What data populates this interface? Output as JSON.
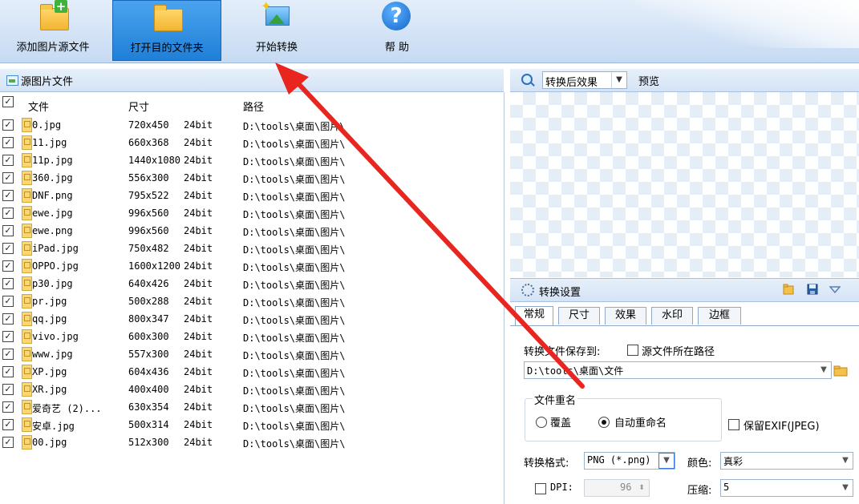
{
  "toolbar": {
    "add_label": "添加图片源文件",
    "open_label": "打开目的文件夹",
    "start_label": "开始转换",
    "help_label": "帮 助"
  },
  "left_panel": {
    "title": "源图片文件",
    "columns": {
      "file": "文件",
      "size": "尺寸",
      "path": "路径"
    },
    "rows": [
      {
        "name": "0.jpg",
        "size": "720x450",
        "bit": "24bit",
        "path": "D:\\tools\\桌面\\图片\\"
      },
      {
        "name": "11.jpg",
        "size": "660x368",
        "bit": "24bit",
        "path": "D:\\tools\\桌面\\图片\\"
      },
      {
        "name": "11p.jpg",
        "size": "1440x1080",
        "bit": "24bit",
        "path": "D:\\tools\\桌面\\图片\\"
      },
      {
        "name": "360.jpg",
        "size": "556x300",
        "bit": "24bit",
        "path": "D:\\tools\\桌面\\图片\\"
      },
      {
        "name": "DNF.png",
        "size": "795x522",
        "bit": "24bit",
        "path": "D:\\tools\\桌面\\图片\\"
      },
      {
        "name": "ewe.jpg",
        "size": "996x560",
        "bit": "24bit",
        "path": "D:\\tools\\桌面\\图片\\"
      },
      {
        "name": "ewe.png",
        "size": "996x560",
        "bit": "24bit",
        "path": "D:\\tools\\桌面\\图片\\"
      },
      {
        "name": "iPad.jpg",
        "size": "750x482",
        "bit": "24bit",
        "path": "D:\\tools\\桌面\\图片\\"
      },
      {
        "name": "OPPO.jpg",
        "size": "1600x1200",
        "bit": "24bit",
        "path": "D:\\tools\\桌面\\图片\\"
      },
      {
        "name": "p30.jpg",
        "size": "640x426",
        "bit": "24bit",
        "path": "D:\\tools\\桌面\\图片\\"
      },
      {
        "name": "pr.jpg",
        "size": "500x288",
        "bit": "24bit",
        "path": "D:\\tools\\桌面\\图片\\"
      },
      {
        "name": "qq.jpg",
        "size": "800x347",
        "bit": "24bit",
        "path": "D:\\tools\\桌面\\图片\\"
      },
      {
        "name": "vivo.jpg",
        "size": "600x300",
        "bit": "24bit",
        "path": "D:\\tools\\桌面\\图片\\"
      },
      {
        "name": "www.jpg",
        "size": "557x300",
        "bit": "24bit",
        "path": "D:\\tools\\桌面\\图片\\"
      },
      {
        "name": "XP.jpg",
        "size": "604x436",
        "bit": "24bit",
        "path": "D:\\tools\\桌面\\图片\\"
      },
      {
        "name": "XR.jpg",
        "size": "400x400",
        "bit": "24bit",
        "path": "D:\\tools\\桌面\\图片\\"
      },
      {
        "name": "爱奇艺 (2)...",
        "size": "630x354",
        "bit": "24bit",
        "path": "D:\\tools\\桌面\\图片\\"
      },
      {
        "name": "安卓.jpg",
        "size": "500x314",
        "bit": "24bit",
        "path": "D:\\tools\\桌面\\图片\\"
      },
      {
        "name": "00.jpg",
        "size": "512x300",
        "bit": "24bit",
        "path": "D:\\tools\\桌面\\图片\\"
      }
    ]
  },
  "right_panel": {
    "effect_select": "转换后效果",
    "preview_label": "预览",
    "settings_title": "转换设置",
    "tabs": [
      "常规",
      "尺寸",
      "效果",
      "水印",
      "边框"
    ],
    "save_to_label": "转换文件保存到:",
    "source_path_label": "源文件所在路径",
    "dest_path": "D:\\tools\\桌面\\文件",
    "rename_group": "文件重名",
    "overwrite_label": "覆盖",
    "auto_rename_label": "自动重命名",
    "keep_exif_label": "保留EXIF(JPEG)",
    "format_label": "转换格式:",
    "format_value": "PNG (*.png)",
    "color_label": "颜色:",
    "color_value": "真彩",
    "dpi_label": "DPI:",
    "dpi_value": "96",
    "compress_label": "压缩:",
    "compress_value": "5"
  },
  "colors": {
    "annotation_arrow": "#e8261f",
    "toolbar_active": "#2b8be0"
  }
}
